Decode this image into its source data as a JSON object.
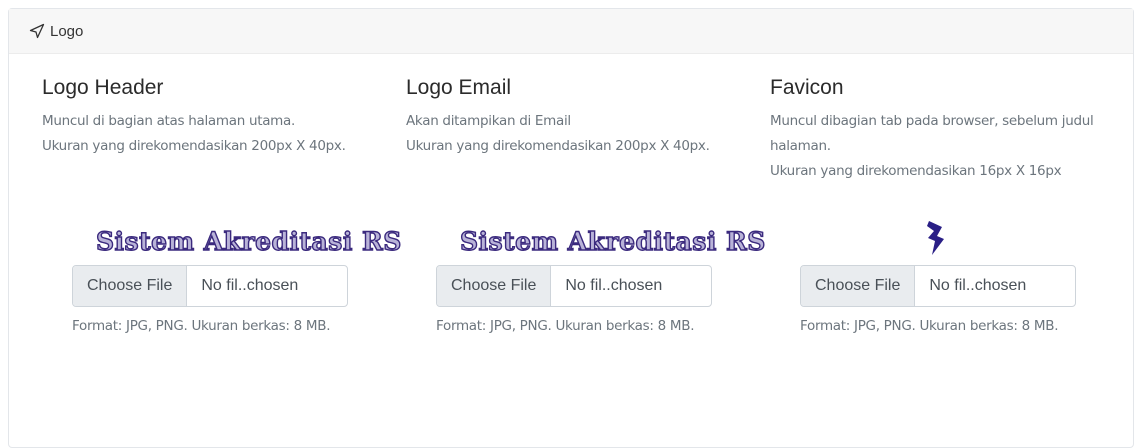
{
  "card": {
    "title": "Logo",
    "title_icon": "send-icon"
  },
  "columns": [
    {
      "heading": "Logo Header",
      "description_lines": [
        "Muncul di bagian atas halaman utama.",
        "Ukuran yang direkomendasikan 200px X 40px."
      ],
      "preview_text": "Sistem Akreditasi RS",
      "file_button": "Choose File",
      "file_name": "No fil..chosen",
      "hint": "Format: JPG, PNG. Ukuran berkas: 8 MB."
    },
    {
      "heading": "Logo Email",
      "description_lines": [
        "Akan ditampikan di Email",
        "Ukuran yang direkomendasikan 200px X 40px."
      ],
      "preview_text": "Sistem Akreditasi RS",
      "file_button": "Choose File",
      "file_name": "No fil..chosen",
      "hint": "Format: JPG, PNG. Ukuran berkas: 8 MB."
    },
    {
      "heading": "Favicon",
      "description_lines": [
        "Muncul dibagian tab pada browser, sebelum judul halaman.",
        "Ukuran yang direkomendasikan 16px X 16px"
      ],
      "preview_icon": "lightning-bolt-icon",
      "file_button": "Choose File",
      "file_name": "No fil..chosen",
      "hint": "Format: JPG, PNG. Ukuran berkas: 8 MB."
    }
  ],
  "colors": {
    "header_bg": "#f7f7f7",
    "muted": "#6c757d",
    "logo_fill": "#b9b3d8",
    "logo_stroke": "#3b2a7e",
    "favicon": "#2a1f86"
  }
}
